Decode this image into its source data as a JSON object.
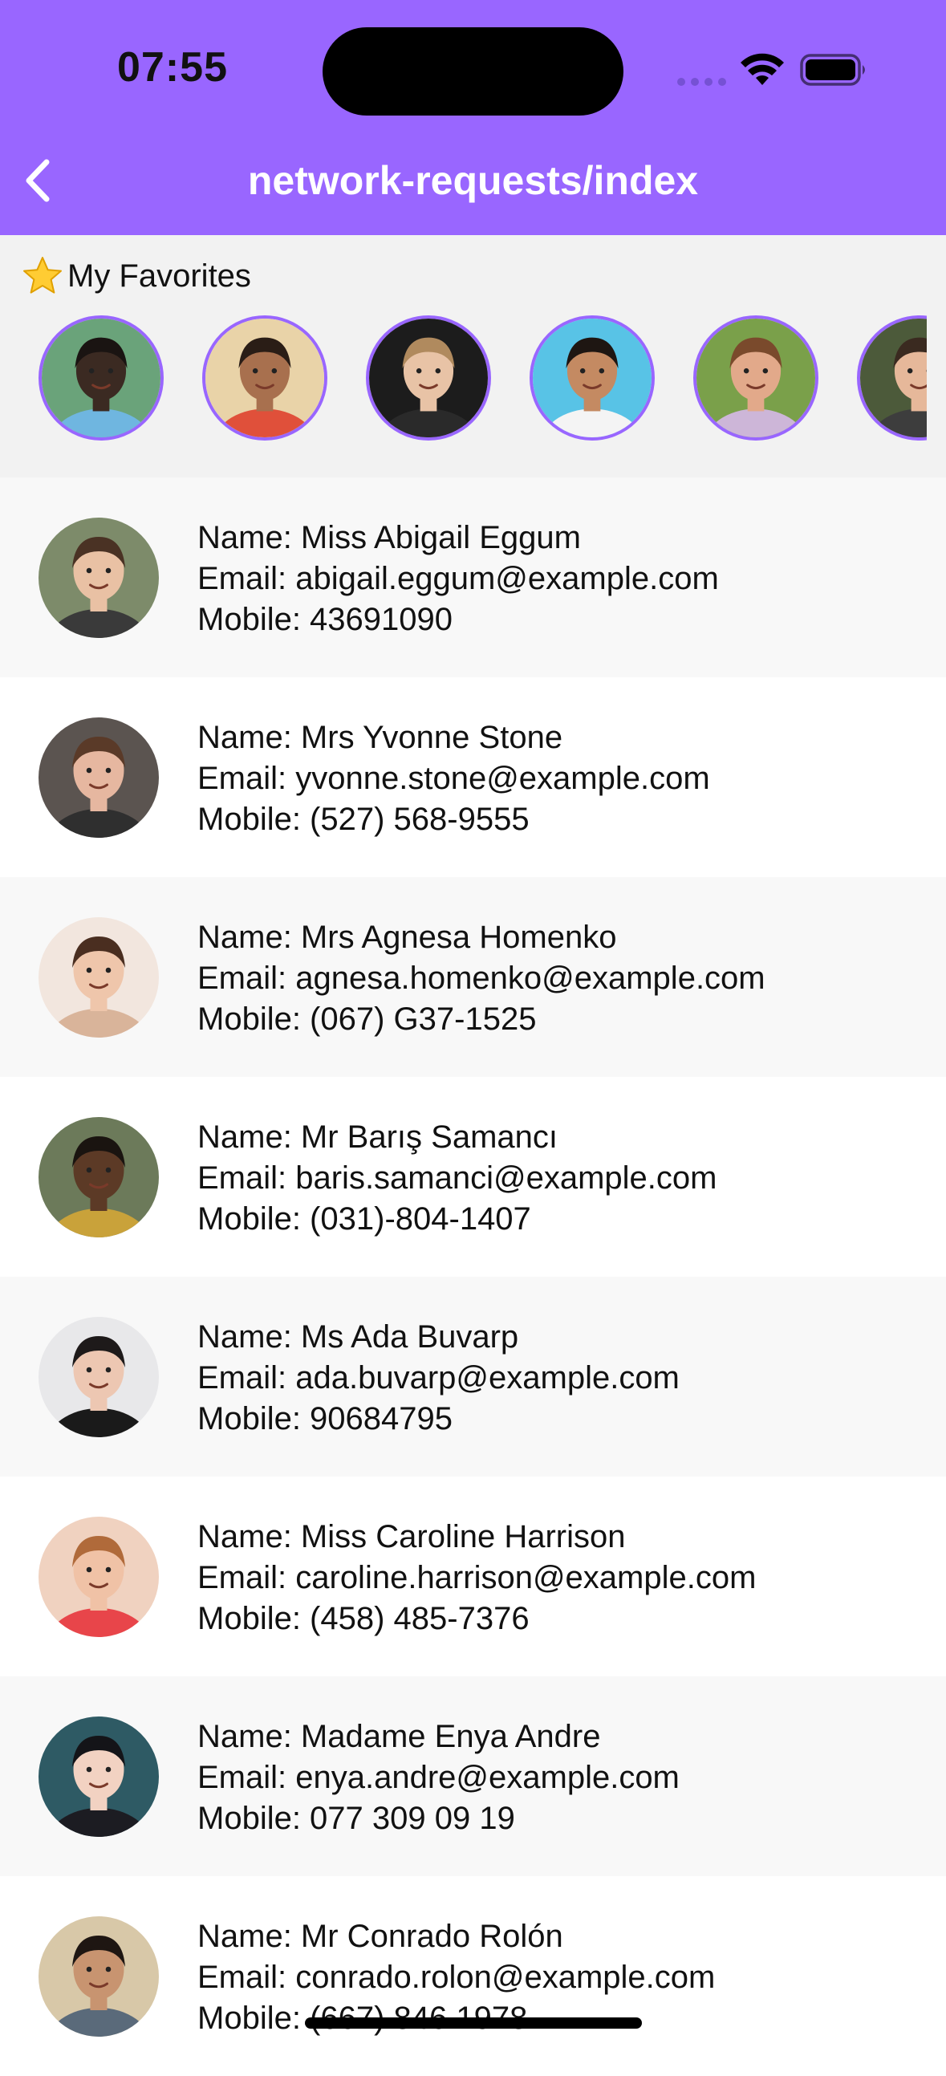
{
  "status_bar": {
    "time": "07:55"
  },
  "nav": {
    "title": "network-requests/index",
    "back_icon": "chevron-left-icon"
  },
  "favorites": {
    "star": "⭐",
    "title": "My Favorites",
    "avatars": [
      {
        "bg": "#6aa37a",
        "skin": "#3b2a22",
        "hair": "#1a1412",
        "shirt": "#6fb6e0"
      },
      {
        "bg": "#e9d3a8",
        "skin": "#a8704e",
        "hair": "#2a1d16",
        "shirt": "#e0503a"
      },
      {
        "bg": "#1c1c1c",
        "skin": "#e8c3a6",
        "hair": "#b08a5e",
        "shirt": "#2a2a2a"
      },
      {
        "bg": "#58c3e6",
        "skin": "#c48a62",
        "hair": "#1e1612",
        "shirt": "#f4f4f4"
      },
      {
        "bg": "#7aa04a",
        "skin": "#e2a98a",
        "hair": "#7a4a2c",
        "shirt": "#cdb6d8"
      },
      {
        "bg": "#4c5a3a",
        "skin": "#e6b89a",
        "hair": "#3a2a20",
        "shirt": "#3d3d3d"
      }
    ]
  },
  "contacts": [
    {
      "name": "Name: Miss Abigail Eggum",
      "email": "Email: abigail.eggum@example.com",
      "mobile": "Mobile: 43691090",
      "colors": {
        "bg": "#7d8b6a",
        "skin": "#e9c1a4",
        "hair": "#4a3224",
        "shirt": "#3a3a3a"
      }
    },
    {
      "name": "Name: Mrs Yvonne Stone",
      "email": "Email: yvonne.stone@example.com",
      "mobile": "Mobile: (527) 568-9555",
      "colors": {
        "bg": "#5b5450",
        "skin": "#e6b7a0",
        "hair": "#5a3a28",
        "shirt": "#2f2f2f"
      }
    },
    {
      "name": "Name: Mrs Agnesa Homenko",
      "email": "Email: agnesa.homenko@example.com",
      "mobile": "Mobile: (067) G37-1525",
      "colors": {
        "bg": "#f2e6de",
        "skin": "#efc6ab",
        "hair": "#4a2e20",
        "shirt": "#d9b49a"
      }
    },
    {
      "name": "Name: Mr Barış Samancı",
      "email": "Email: baris.samanci@example.com",
      "mobile": "Mobile: (031)-804-1407",
      "colors": {
        "bg": "#6c7a5a",
        "skin": "#5c3a26",
        "hair": "#1a1410",
        "shirt": "#c9a23a"
      }
    },
    {
      "name": "Name: Ms Ada Buvarp",
      "email": "Email: ada.buvarp@example.com",
      "mobile": "Mobile: 90684795",
      "colors": {
        "bg": "#e8e8ea",
        "skin": "#edc7b2",
        "hair": "#1e1a1a",
        "shirt": "#1a1a1a"
      }
    },
    {
      "name": "Name: Miss Caroline Harrison",
      "email": "Email: caroline.harrison@example.com",
      "mobile": "Mobile: (458) 485-7376",
      "colors": {
        "bg": "#f0d2c0",
        "skin": "#f0c2a6",
        "hair": "#b06a3a",
        "shirt": "#e8454a"
      }
    },
    {
      "name": "Name: Madame Enya Andre",
      "email": "Email: enya.andre@example.com",
      "mobile": "Mobile: 077 309 09 19",
      "colors": {
        "bg": "#2e5a64",
        "skin": "#f2d2c2",
        "hair": "#141418",
        "shirt": "#1c1c22"
      }
    },
    {
      "name": "Name: Mr Conrado Rolón",
      "email": "Email: conrado.rolon@example.com",
      "mobile": "Mobile: (667) 846 1978",
      "colors": {
        "bg": "#d8c8a8",
        "skin": "#c89470",
        "hair": "#1e1612",
        "shirt": "#5a6a7a"
      }
    }
  ]
}
